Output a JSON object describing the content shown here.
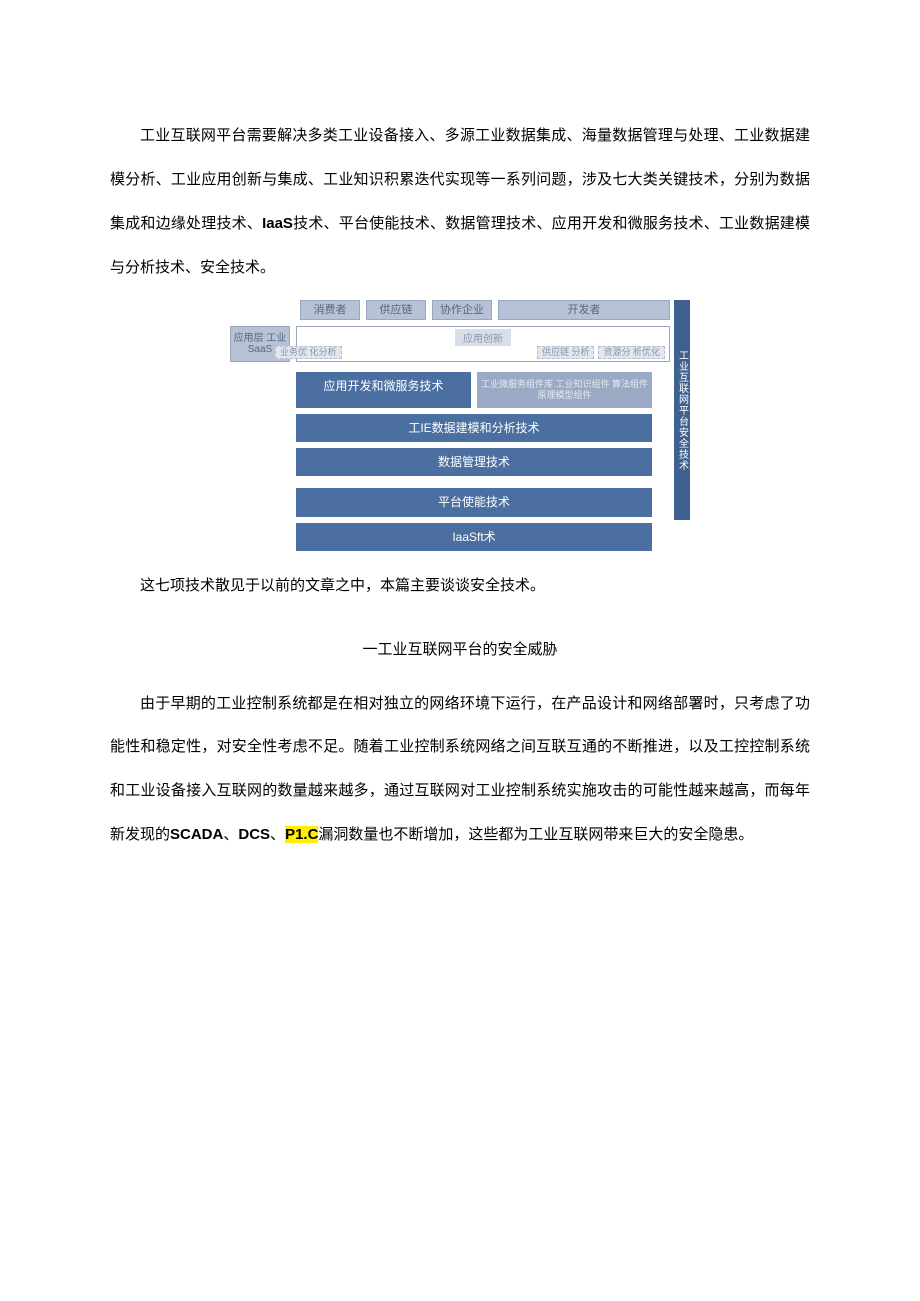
{
  "paragraphs": {
    "p1": "工业互联网平台需要解决多类工业设备接入、多源工业数据集成、海量数据管理与处理、工业数据建模分析、工业应用创新与集成、工业知识积累迭代实现等一系列问题，涉及七大类关键技术，分别为数据集成和边缘处理技术、",
    "p1_b1": "IaaS",
    "p1_cont": "技术、平台使能技术、数据管理技术、应用开发和微服务技术、工业数据建模与分析技术、安全技术。",
    "p2": "这七项技术散见于以前的文章之中，本篇主要谈谈安全技术。",
    "section_title": "一工业互联网平台的安全威胁",
    "p3_a": "由于早期的工业控制系统都是在相对独立的网络环境下运行，在产品设计和网络部署时，只考虑了功能性和稳定性，对安全性考虑不足。随着工业控制系统网络之间互联互通的不断推进，以及工控控制系统和工业设备接入互联网的数量越来越多，通过互联网对工业控制系统实施攻击的可能性越来越高，而每年新发现的",
    "p3_b1": "SCADA",
    "p3_sep1": "、",
    "p3_b2": "DCS",
    "p3_sep2": "、",
    "p3_hl": "P1.C",
    "p3_b": "漏洞数量也不断增加，这些都为工业互联网带来巨大的安全隐患。"
  },
  "diagram": {
    "top": {
      "b1": "消费者",
      "b2": "供应链",
      "b3": "协作企业",
      "b4": "开发者"
    },
    "row2_left": "应用层\n工业SaaS",
    "row2_mid_label": "应用创新",
    "row2_minis": {
      "m0": "业务优\n化分析",
      "m1": "供应链\n分析",
      "m2": "资源分\n析优化"
    },
    "layers": {
      "l1a": "应用开发和微服务技术",
      "l1b": "工业微服务组件库\n工业知识组件  算法组件  原理模型组件",
      "l2": "工IE数据建模和分析技术",
      "l3": "数据管理技术",
      "l4": "平台使能技术",
      "l5": "IaaSft术"
    },
    "sidebar": "工业互联网平台安全技术"
  }
}
